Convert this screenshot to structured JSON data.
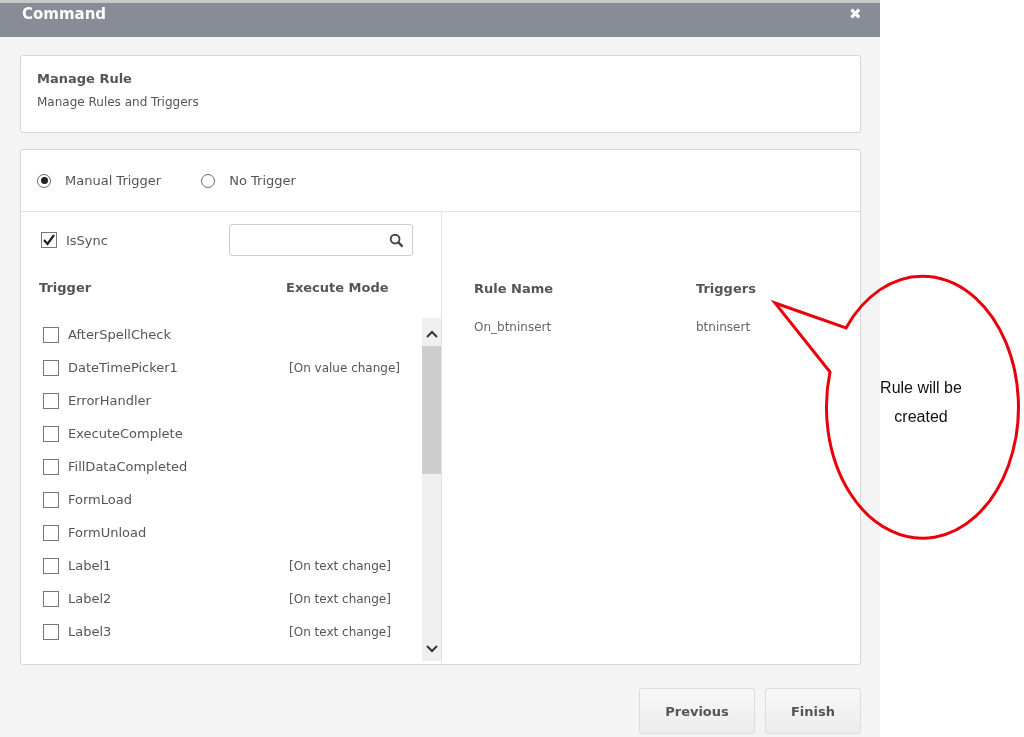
{
  "window": {
    "title": "Command",
    "close": "✖"
  },
  "header": {
    "title": "Manage Rule",
    "subtitle": "Manage Rules and Triggers"
  },
  "trigger_options": [
    {
      "label": "Manual Trigger",
      "selected": true
    },
    {
      "label": "No Trigger",
      "selected": false
    }
  ],
  "is_sync": {
    "label": "IsSync",
    "checked": true
  },
  "trigger_table": {
    "columns": [
      "Trigger",
      "Execute Mode"
    ],
    "rows": [
      {
        "name": "AfterSpellCheck",
        "checked": false
      },
      {
        "name": "DateTimePicker1",
        "mode": "[On value change]",
        "checked": false
      },
      {
        "name": "ErrorHandler",
        "checked": false
      },
      {
        "name": "ExecuteComplete",
        "checked": false
      },
      {
        "name": "FillDataCompleted",
        "checked": false
      },
      {
        "name": "FormLoad",
        "checked": false
      },
      {
        "name": "FormUnload",
        "checked": false
      },
      {
        "name": "Label1",
        "mode": "[On text change]",
        "checked": false
      },
      {
        "name": "Label2",
        "mode": "[On text change]",
        "checked": false
      },
      {
        "name": "Label3",
        "mode": "[On text change]",
        "checked": false
      }
    ]
  },
  "rule_table": {
    "columns": [
      "Rule Name",
      "Triggers"
    ],
    "rows": [
      {
        "rule_name": "On_btninsert",
        "triggers": "btninsert"
      }
    ]
  },
  "buttons": [
    "Previous",
    "Finish"
  ],
  "callout": {
    "text": "Rule will be created"
  }
}
